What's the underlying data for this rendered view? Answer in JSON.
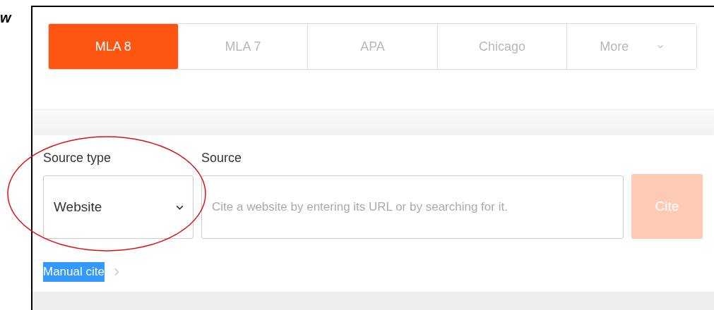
{
  "edge_text": "w",
  "tabs": [
    {
      "label": "MLA 8",
      "selected": true
    },
    {
      "label": "MLA 7",
      "selected": false
    },
    {
      "label": "APA",
      "selected": false
    },
    {
      "label": "Chicago",
      "selected": false
    },
    {
      "label": "More",
      "selected": false,
      "kind": "dropdown"
    }
  ],
  "form": {
    "source_type": {
      "label": "Source type",
      "value": "Website"
    },
    "source": {
      "label": "Source",
      "placeholder": "Cite a website by entering its URL or by searching for it."
    },
    "cite_button": {
      "label": "Cite",
      "disabled": true
    }
  },
  "manual_cite": {
    "label": "Manual cite",
    "highlighted": true
  },
  "annotation": {
    "kind": "ellipse",
    "color": "#e01010"
  }
}
